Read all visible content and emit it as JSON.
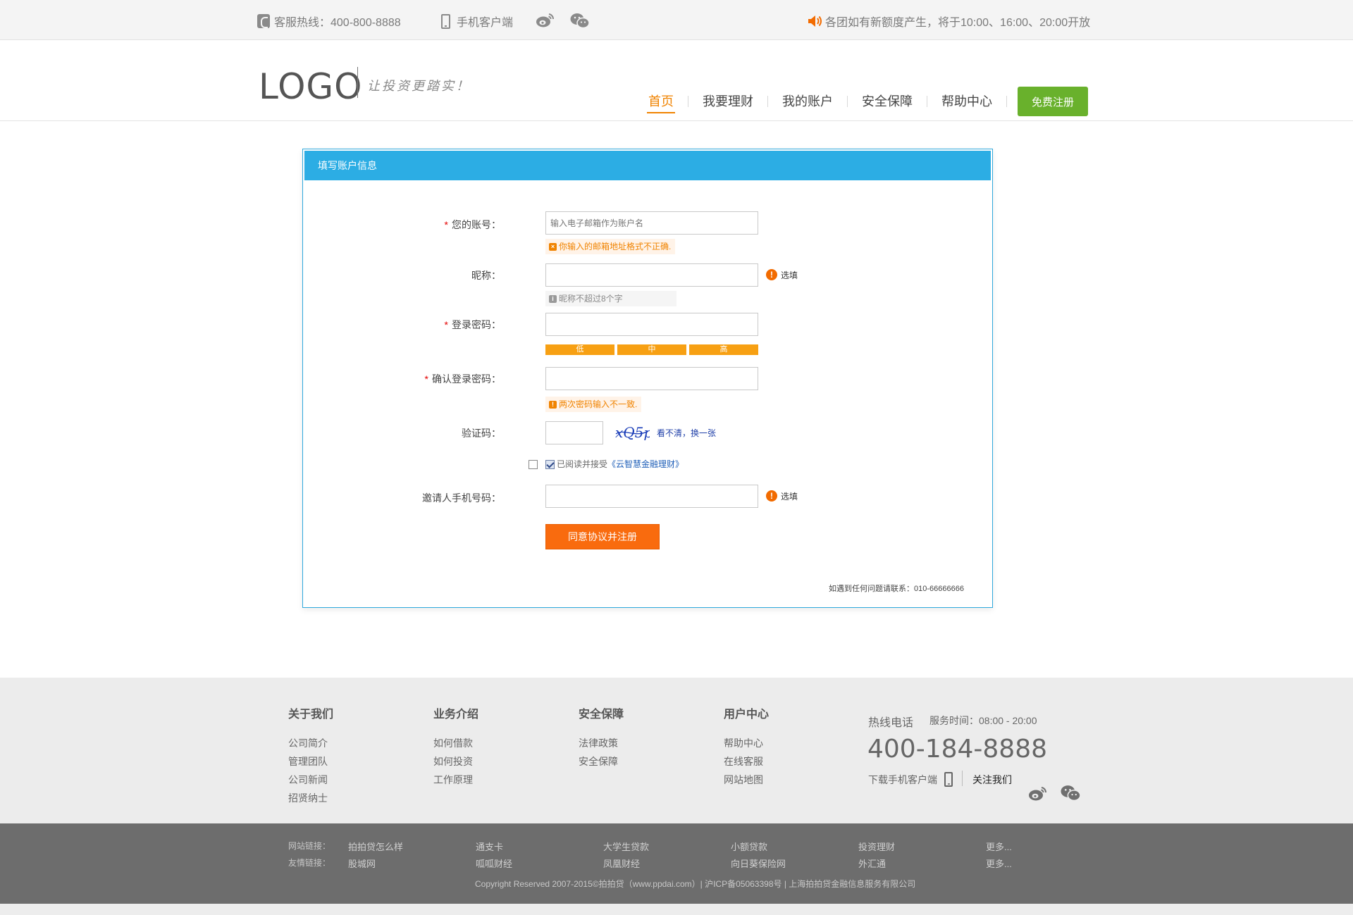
{
  "topbar": {
    "hotline": "客服热线：400-800-8888",
    "mobile_client": "手机客户端",
    "notice": "各团如有新额度产生，将于10:00、16:00、20:00开放",
    "icons": [
      "phone-icon",
      "mobile-icon",
      "weibo-icon",
      "wechat-icon",
      "speaker-icon"
    ]
  },
  "header": {
    "logo": "LOGO",
    "slogan": "让投资更踏实！",
    "nav": [
      "首页",
      "我要理财",
      "我的账户",
      "安全保障",
      "帮助中心"
    ],
    "active_nav": "首页",
    "register_button": "免费注册"
  },
  "form": {
    "title": "填写账户信息",
    "account": {
      "label": "您的账号：",
      "placeholder": "输入电子邮箱作为账户名",
      "error": "你输入的邮箱地址格式不正确."
    },
    "nickname": {
      "label": "昵称：",
      "optional": "选填",
      "hint": "昵称不超过8个字"
    },
    "password": {
      "label": "登录密码：",
      "strength": [
        "低",
        "中",
        "高"
      ]
    },
    "confirm_password": {
      "label": "确认登录密码：",
      "error": "两次密码输入不一致."
    },
    "captcha": {
      "label": "验证码：",
      "image_text": "xQ5p",
      "refresh": "看不清，换一张"
    },
    "agreement": {
      "text": "已阅读并接受",
      "link": "《云智慧金融理财》",
      "checked": true
    },
    "inviter": {
      "label": "邀请人手机号码：",
      "optional": "选填"
    },
    "submit": "同意协议并注册",
    "contact": "如遇到任何问题请联系：010-66666666"
  },
  "footer": {
    "columns": [
      {
        "title": "关于我们",
        "links": [
          "公司简介",
          "管理团队",
          "公司新闻",
          "招贤纳士"
        ]
      },
      {
        "title": "业务介绍",
        "links": [
          "如何借款",
          "如何投资",
          "工作原理"
        ]
      },
      {
        "title": "安全保障",
        "links": [
          "法律政策",
          "安全保障"
        ]
      },
      {
        "title": "用户中心",
        "links": [
          "帮助中心",
          "在线客服",
          "网站地图"
        ]
      }
    ],
    "hotline_title": "热线电话",
    "service_time": "服务时间：08:00 - 20:00",
    "hotline_number": "400-184-8888",
    "download_app": "下载手机客户端",
    "follow_us": "关注我们",
    "site_links_label": "网站链接：",
    "site_links": [
      "拍拍贷怎么样",
      "通支卡",
      "大学生贷款",
      "小额贷款",
      "投资理财",
      "更多..."
    ],
    "friend_links_label": "友情链接：",
    "friend_links": [
      "股城网",
      "呱呱财经",
      "凤凰财经",
      "向日葵保险网",
      "外汇通",
      "更多..."
    ],
    "copyright": "Copyright Reserved 2007-2015©拍拍贷（www.ppdai.com）| 沪ICP备05063398号 | 上海拍拍贷金融信息服务有限公司"
  },
  "colors": {
    "accent_orange": "#f08300",
    "panel_blue": "#2cade4",
    "register_green": "#69b12c",
    "submit_orange": "#f96b0e"
  }
}
